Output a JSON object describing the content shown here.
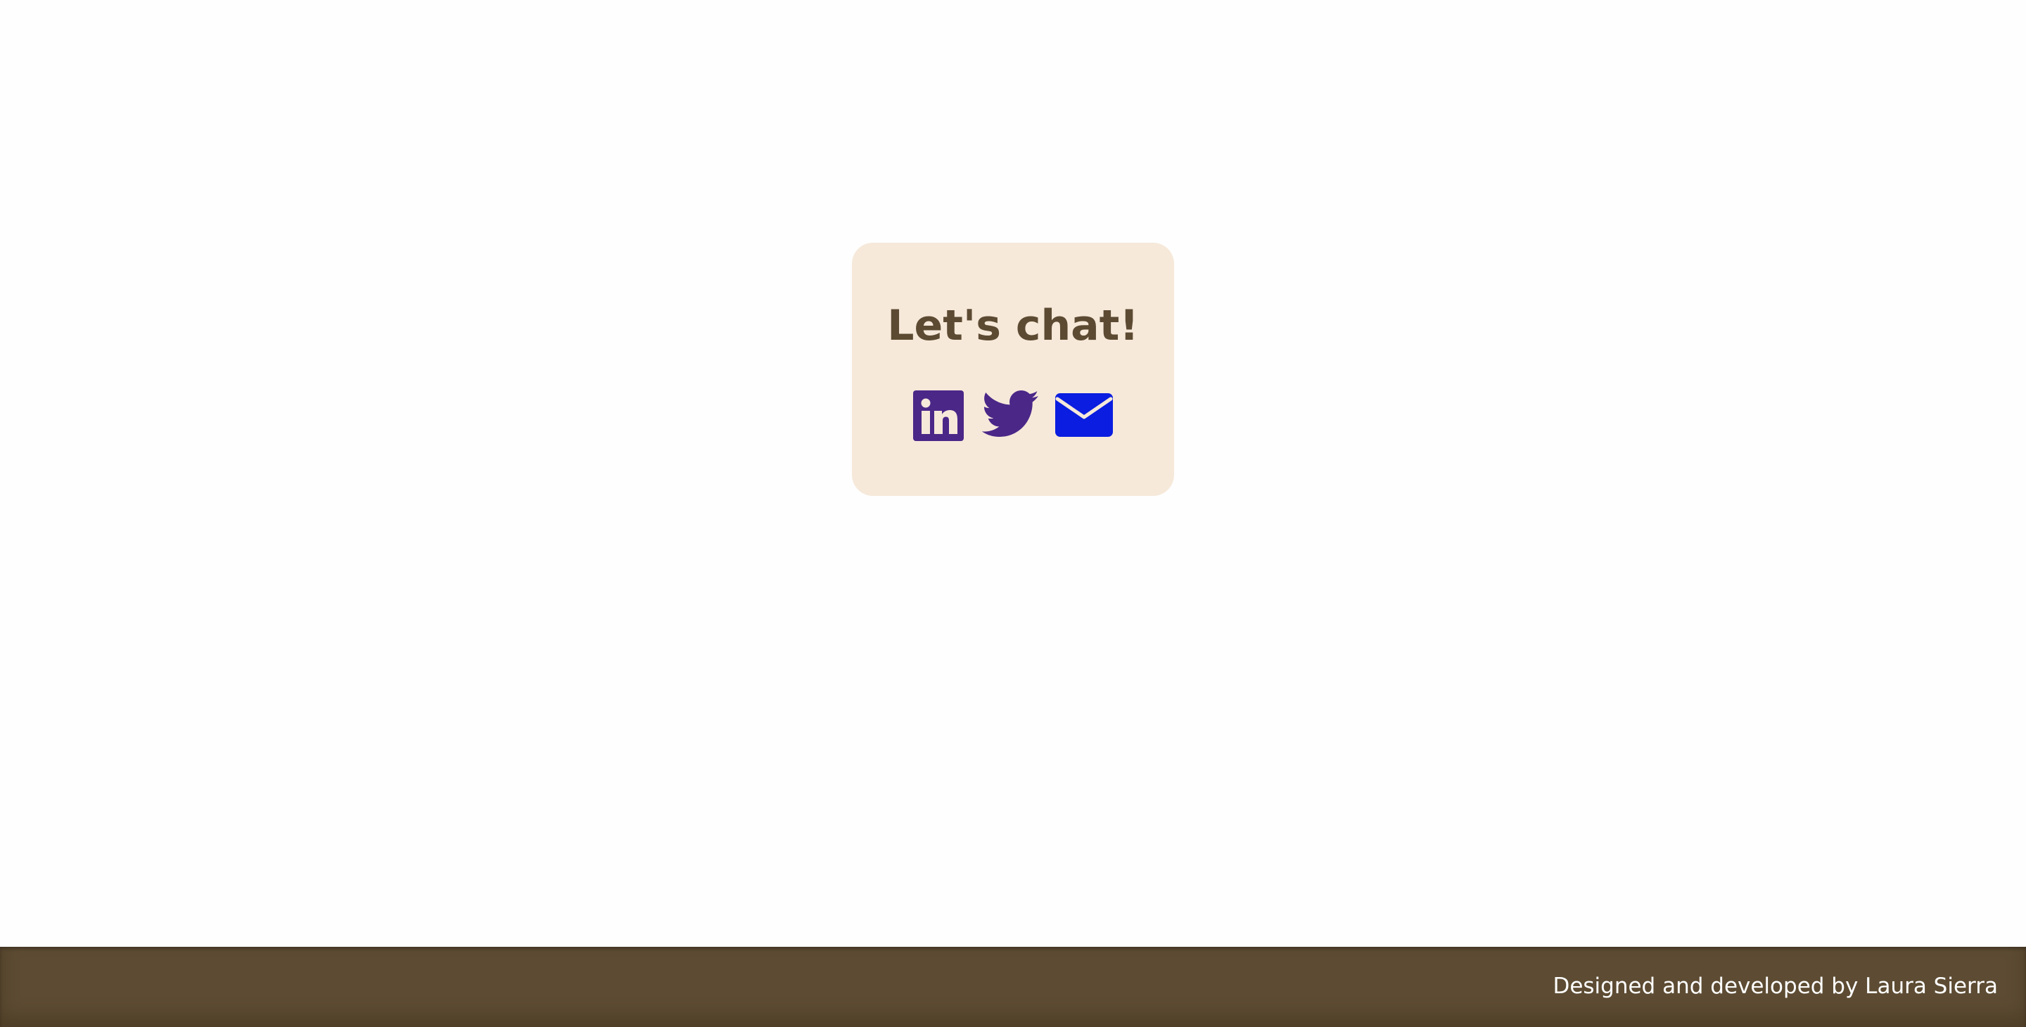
{
  "contact_card": {
    "title": "Let's chat!",
    "background_color": "#f6e9da",
    "title_color": "#5c4a32",
    "social_links": [
      {
        "name": "linkedin",
        "icon": "linkedin-icon",
        "color": "#4b2788"
      },
      {
        "name": "twitter",
        "icon": "twitter-bird-icon",
        "color": "#4b2788"
      },
      {
        "name": "email",
        "icon": "envelope-icon",
        "color": "#0a1de0"
      }
    ]
  },
  "footer": {
    "credit": "Designed and developed by Laura Sierra",
    "background_color": "#5d4c33",
    "text_color": "#ffffff"
  }
}
